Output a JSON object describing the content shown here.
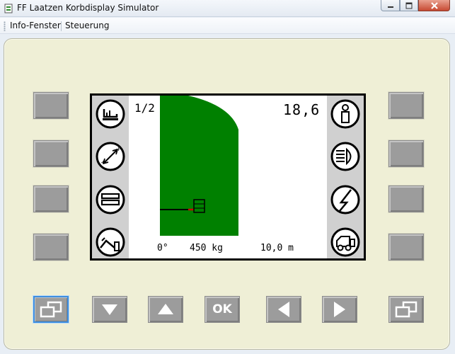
{
  "window": {
    "title": "FF Laatzen Korbdisplay Simulator",
    "icon": "app-icon",
    "controls": [
      "minimize-icon",
      "maximize-icon",
      "close-icon"
    ]
  },
  "menu": {
    "items": [
      {
        "label": "Info-Fenster"
      },
      {
        "label": "Steuerung"
      }
    ]
  },
  "display": {
    "page_indicator": "1/2",
    "top_value": "18,6",
    "angle": "0°",
    "load": "450 kg",
    "length": "10,0 m",
    "left_icons": [
      "basket-icon",
      "boom-extend-icon",
      "stack-icon",
      "fold-boom-icon"
    ],
    "right_icons": [
      "person-info-icon",
      "headlight-icon",
      "lightning-icon",
      "vehicle-icon"
    ],
    "colors": {
      "working_area": "#008000",
      "icon_column": "#d0d0d0",
      "screen_border": "#000000"
    }
  },
  "buttons": {
    "left_softkeys": 4,
    "right_softkeys": 4,
    "nav": [
      {
        "name": "screen-switch-left",
        "icon": "windows-icon"
      },
      {
        "name": "down",
        "icon": "arrow-down-icon"
      },
      {
        "name": "up",
        "icon": "arrow-up-icon"
      },
      {
        "name": "ok",
        "label": "OK"
      },
      {
        "name": "left",
        "icon": "arrow-left-icon"
      },
      {
        "name": "right",
        "icon": "arrow-right-icon"
      },
      {
        "name": "screen-switch-right",
        "icon": "windows-icon"
      }
    ],
    "colors": {
      "key_face": "#9c9c9c",
      "selected_outline": "#3d8ee0",
      "panel": "#efefd6"
    }
  }
}
